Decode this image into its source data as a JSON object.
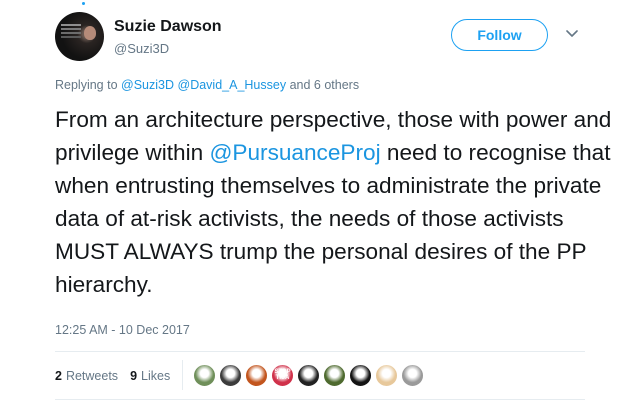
{
  "user": {
    "name": "Suzie Dawson",
    "handle": "@Suzi3D"
  },
  "follow_label": "Follow",
  "reply": {
    "prefix": "Replying to",
    "mentions": [
      "@Suzi3D",
      "@David_A_Hussey"
    ],
    "suffix": "and 6 others"
  },
  "tweet": {
    "part1": "From an architecture perspective, those with power and privilege within ",
    "mention": "@PursuanceProj",
    "part2": " need to recognise that when entrusting themselves to administrate the private data of at-risk activists, the needs of those activists MUST ALWAYS trump the personal desires of the PP hierarchy."
  },
  "timestamp": "12:25 AM - 10 Dec 2017",
  "stats": {
    "retweets_count": "2",
    "retweets_label": "Retweets",
    "likes_count": "9",
    "likes_label": "Likes"
  },
  "likers": [
    {
      "icon": "avatar-landscape",
      "color": "#6f8f5a"
    },
    {
      "icon": "avatar-portrait",
      "color": "#3c3c3c"
    },
    {
      "icon": "avatar-sunset",
      "color": "#c2551e"
    },
    {
      "icon": "avatar-badge",
      "color": "#d0314a",
      "text": "STOP TISA"
    },
    {
      "icon": "avatar-dark",
      "color": "#222222"
    },
    {
      "icon": "avatar-green",
      "color": "#4e6a2f"
    },
    {
      "icon": "avatar-black",
      "color": "#141414"
    },
    {
      "icon": "avatar-glasses",
      "color": "#e7c89b"
    },
    {
      "icon": "avatar-grey",
      "color": "#9a9a9a"
    }
  ],
  "colors": {
    "accent": "#1da1f2",
    "link": "#1b95e0",
    "muted": "#657786",
    "text": "#14171a"
  }
}
